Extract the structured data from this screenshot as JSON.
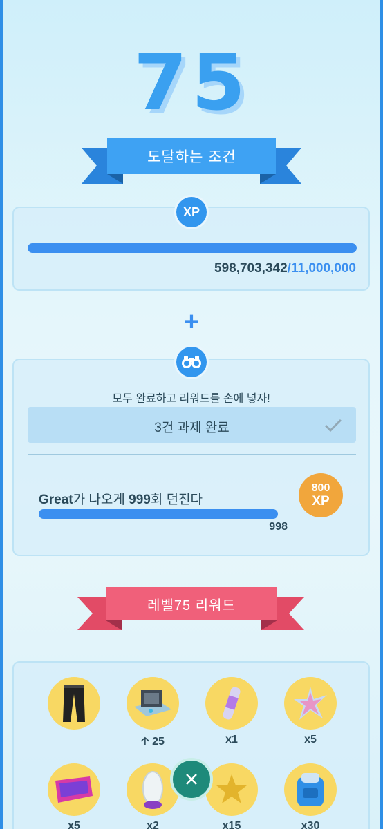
{
  "level": "75",
  "requirements_ribbon": "도달하는 조건",
  "xp_card": {
    "badge": "XP",
    "current": "598,703,342",
    "separator": "/",
    "goal": "11,000,000",
    "progress": 1.0
  },
  "plus": "+",
  "task_card": {
    "subtitle": "모두 완료하고 리워드를 손에 넣자!",
    "completed_label": "3건 과제 완료",
    "task": {
      "prefix": "Great",
      "middle": "가 나오게 ",
      "count": "999",
      "suffix": "회 던진다",
      "progress_value": "998",
      "progress": 0.999,
      "reward_amount": "800",
      "reward_unit": "XP"
    }
  },
  "rewards_ribbon": "레벨75 리워드",
  "rewards": [
    {
      "name": "pants",
      "label": ""
    },
    {
      "name": "incubator-upgrade",
      "label": "25"
    },
    {
      "name": "elite-tm",
      "label": "x1"
    },
    {
      "name": "star-piece",
      "label": "x5"
    },
    {
      "name": "lure-module",
      "label": "x5"
    },
    {
      "name": "incubator",
      "label": "x2"
    },
    {
      "name": "star-item",
      "label": "x15"
    },
    {
      "name": "bag-upgrade",
      "label": "x30"
    }
  ],
  "colors": {
    "accent": "#3b8ff0",
    "ribbon_blue": "#3ea2f3",
    "ribbon_pink": "#f0607a",
    "reward_bg": "#f8d863",
    "xp_reward": "#f1a63c"
  }
}
